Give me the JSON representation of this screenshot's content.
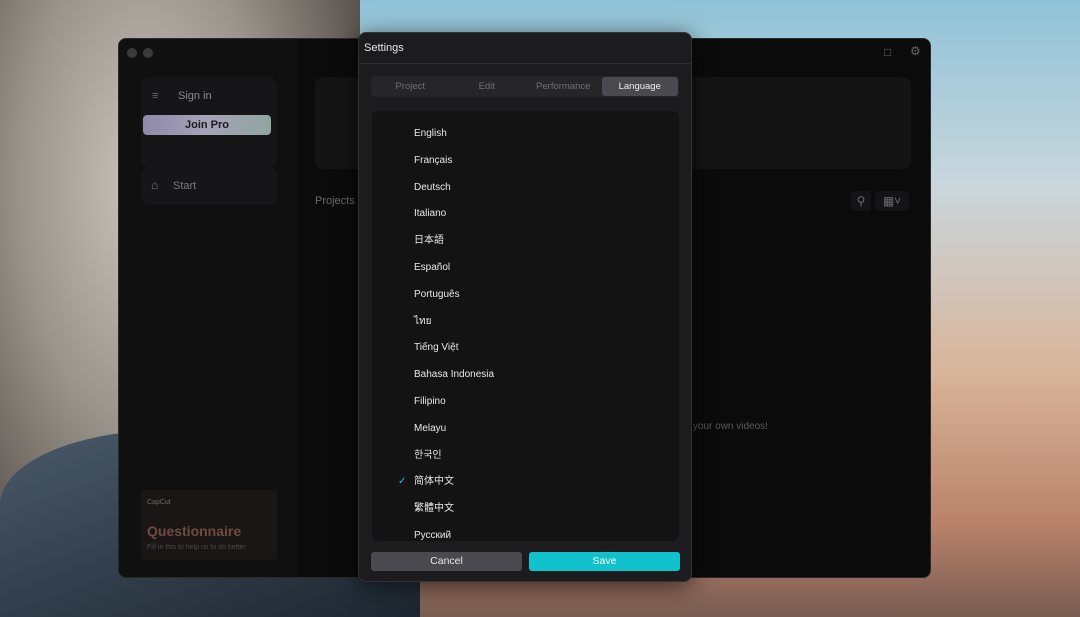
{
  "app": {
    "sidebar": {
      "sign_in": "Sign in",
      "join_pro": "Join Pro",
      "start": "Start",
      "questionnaire": {
        "brand": "CapCut",
        "title": "Questionnaire",
        "subtitle": "Fill in this to help us to do better"
      }
    },
    "main": {
      "projects_label": "Projects",
      "empty_hint": "ng your own videos!"
    }
  },
  "settings": {
    "title": "Settings",
    "tabs": [
      {
        "label": "Project"
      },
      {
        "label": "Edit"
      },
      {
        "label": "Performance"
      },
      {
        "label": "Language",
        "active": true
      }
    ],
    "languages": [
      "English",
      "Français",
      "Deutsch",
      "Italiano",
      "日本語",
      "Español",
      "Português",
      "ไทย",
      "Tiếng Việt",
      "Bahasa Indonesia",
      "Filipino",
      "Melayu",
      "한국인",
      "简体中文",
      "繁體中文",
      "Русский"
    ],
    "selected_language": "简体中文",
    "cancel_label": "Cancel",
    "save_label": "Save"
  },
  "colors": {
    "accent": "#10c2cc"
  }
}
